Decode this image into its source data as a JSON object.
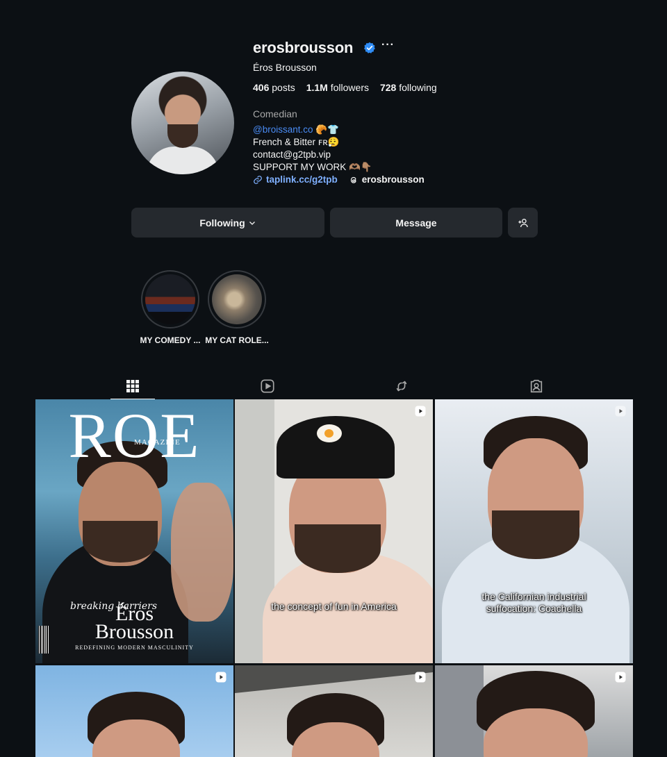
{
  "profile": {
    "username": "erosbrousson",
    "full_name": "Éros Brousson",
    "stats": {
      "posts_count": "406",
      "posts_label": "posts",
      "followers_count": "1.1M",
      "followers_label": "followers",
      "following_count": "728",
      "following_label": "following"
    },
    "category": "Comedian",
    "bio": {
      "mention": "@broissant.co",
      "mention_emoji": "🥐👕",
      "line2": "French & Bitter ꜰʀ😮‍💨",
      "line3": "contact@g2tpb.vip",
      "line4": "SUPPORT MY WORK 🫶🏽👇🏽"
    },
    "link": "taplink.cc/g2tpb",
    "threads_handle": "erosbrousson",
    "colors": {
      "accent": "#4a8cf5",
      "link": "#7fb0ff",
      "verified": "#2f8cf5"
    }
  },
  "actions": {
    "following_label": "Following",
    "message_label": "Message"
  },
  "highlights": [
    {
      "label": "MY COMEDY ..."
    },
    {
      "label": "MY CAT ROLE..."
    }
  ],
  "tabs": [
    {
      "icon": "grid-icon",
      "active": true
    },
    {
      "icon": "reels-icon",
      "active": false
    },
    {
      "icon": "reposts-icon",
      "active": false
    },
    {
      "icon": "tagged-icon",
      "active": false
    }
  ],
  "posts": [
    {
      "type": "image",
      "magazine": {
        "title": "ROE",
        "subtitle": "MAGAZINE",
        "script": "breaking barriers",
        "name_line1": "Éros",
        "name_line2": "Brousson",
        "tagline": "REDEFINING MODERN MASCULINITY"
      }
    },
    {
      "type": "reel",
      "caption": "the concept of fun in America"
    },
    {
      "type": "reel",
      "caption_line1": "the Californian industrial",
      "caption_line2": "suffocation: Coachella"
    },
    {
      "type": "reel"
    },
    {
      "type": "reel"
    },
    {
      "type": "reel"
    }
  ]
}
